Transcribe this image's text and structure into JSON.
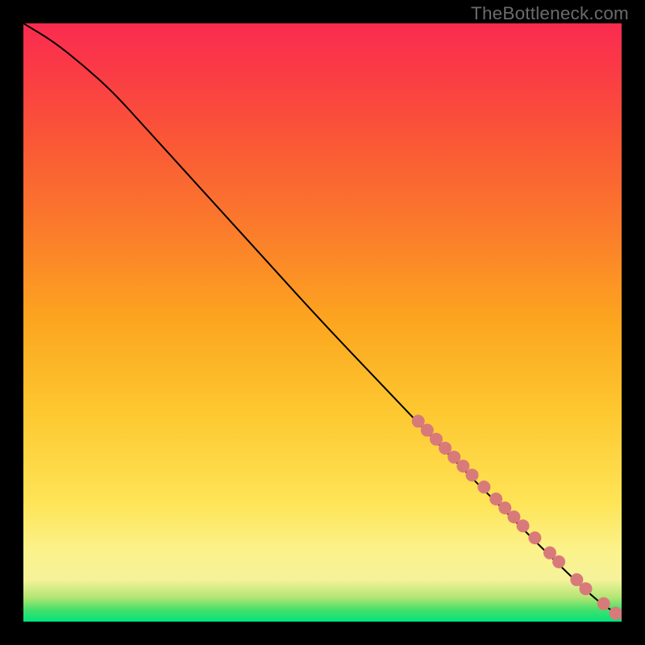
{
  "watermark": "TheBottleneck.com",
  "chart_data": {
    "type": "line",
    "title": "",
    "xlabel": "",
    "ylabel": "",
    "xlim": [
      0,
      100
    ],
    "ylim": [
      0,
      100
    ],
    "background_gradient_stops": [
      {
        "pos": 0.0,
        "color": "#00e37c"
      },
      {
        "pos": 0.02,
        "color": "#46e06a"
      },
      {
        "pos": 0.04,
        "color": "#b1e573"
      },
      {
        "pos": 0.07,
        "color": "#f5f29a"
      },
      {
        "pos": 0.12,
        "color": "#fbf28a"
      },
      {
        "pos": 0.2,
        "color": "#fee456"
      },
      {
        "pos": 0.35,
        "color": "#fdc830"
      },
      {
        "pos": 0.5,
        "color": "#fca61f"
      },
      {
        "pos": 0.65,
        "color": "#fb7d2b"
      },
      {
        "pos": 0.8,
        "color": "#fa5836"
      },
      {
        "pos": 0.92,
        "color": "#fa3b45"
      },
      {
        "pos": 1.0,
        "color": "#fa2b4f"
      }
    ],
    "curve": [
      {
        "x": 0,
        "y": 100
      },
      {
        "x": 5,
        "y": 97
      },
      {
        "x": 10,
        "y": 93
      },
      {
        "x": 15,
        "y": 88.5
      },
      {
        "x": 20,
        "y": 83
      },
      {
        "x": 30,
        "y": 72
      },
      {
        "x": 40,
        "y": 61
      },
      {
        "x": 50,
        "y": 50
      },
      {
        "x": 60,
        "y": 39.5
      },
      {
        "x": 70,
        "y": 29
      },
      {
        "x": 80,
        "y": 19
      },
      {
        "x": 90,
        "y": 9
      },
      {
        "x": 97,
        "y": 2.5
      },
      {
        "x": 100,
        "y": 1.2
      }
    ],
    "markers": [
      {
        "x": 66,
        "y": 33.5
      },
      {
        "x": 67.5,
        "y": 32
      },
      {
        "x": 69,
        "y": 30.5
      },
      {
        "x": 70.5,
        "y": 29
      },
      {
        "x": 72,
        "y": 27.5
      },
      {
        "x": 73.5,
        "y": 26
      },
      {
        "x": 75,
        "y": 24.5
      },
      {
        "x": 77,
        "y": 22.5
      },
      {
        "x": 79,
        "y": 20.5
      },
      {
        "x": 80.5,
        "y": 19
      },
      {
        "x": 82,
        "y": 17.5
      },
      {
        "x": 83.5,
        "y": 16
      },
      {
        "x": 85.5,
        "y": 14
      },
      {
        "x": 88,
        "y": 11.5
      },
      {
        "x": 89.5,
        "y": 10
      },
      {
        "x": 92.5,
        "y": 7
      },
      {
        "x": 94,
        "y": 5.5
      },
      {
        "x": 97,
        "y": 3
      },
      {
        "x": 99,
        "y": 1.4
      },
      {
        "x": 100.5,
        "y": 1.2
      }
    ],
    "marker_radius": 8,
    "marker_color": "#d97a7a",
    "curve_color": "#000000",
    "curve_width": 2
  }
}
